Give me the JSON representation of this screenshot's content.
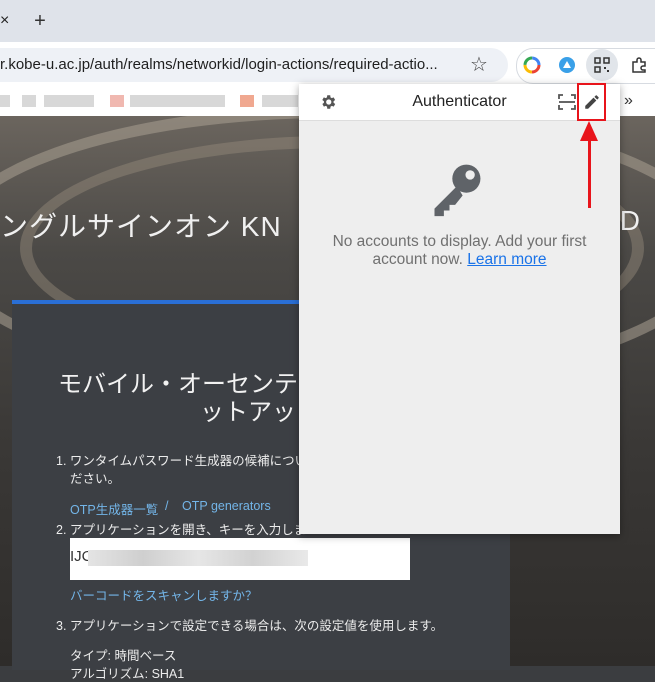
{
  "browser": {
    "tab_close": "×",
    "new_tab": "+",
    "url": "r.kobe-u.ac.jp/auth/realms/networkid/login-actions/required-actio...",
    "star_icon": "☆",
    "more_chevron": "»"
  },
  "page": {
    "sso_title": "ングルサインオン KN",
    "sso_title_right": "ID",
    "setup_title_line1": "モバイル・オーセンテ",
    "setup_title_line2": "ットアッ",
    "step1": "1. ワンタイムパスワード生成器の候補につい",
    "step1_cont": "ださい。",
    "otp_link_ja": "OTP生成器一覧",
    "otp_link_sep": "/",
    "otp_link_en": "OTP generators",
    "step2": "2. アプリケーションを開き、キーを入力しま",
    "key_prefix": "IJC",
    "barcode_link": "バーコードをスキャンしますか？",
    "step3": "3. アプリケーションで設定できる場合は、次の設定値を使用します。",
    "type_label": "タイプ: 時間ベース",
    "algo_label": "アルゴリズム: SHA1"
  },
  "popup": {
    "title": "Authenticator",
    "empty_line1": "No accounts to display. Add your first",
    "empty_line2": "account now.",
    "learn_more": "Learn more"
  },
  "colors": {
    "annotation_red": "#e8141b",
    "link_blue": "#1a73e8",
    "panel_accent": "#2a6fd6"
  }
}
